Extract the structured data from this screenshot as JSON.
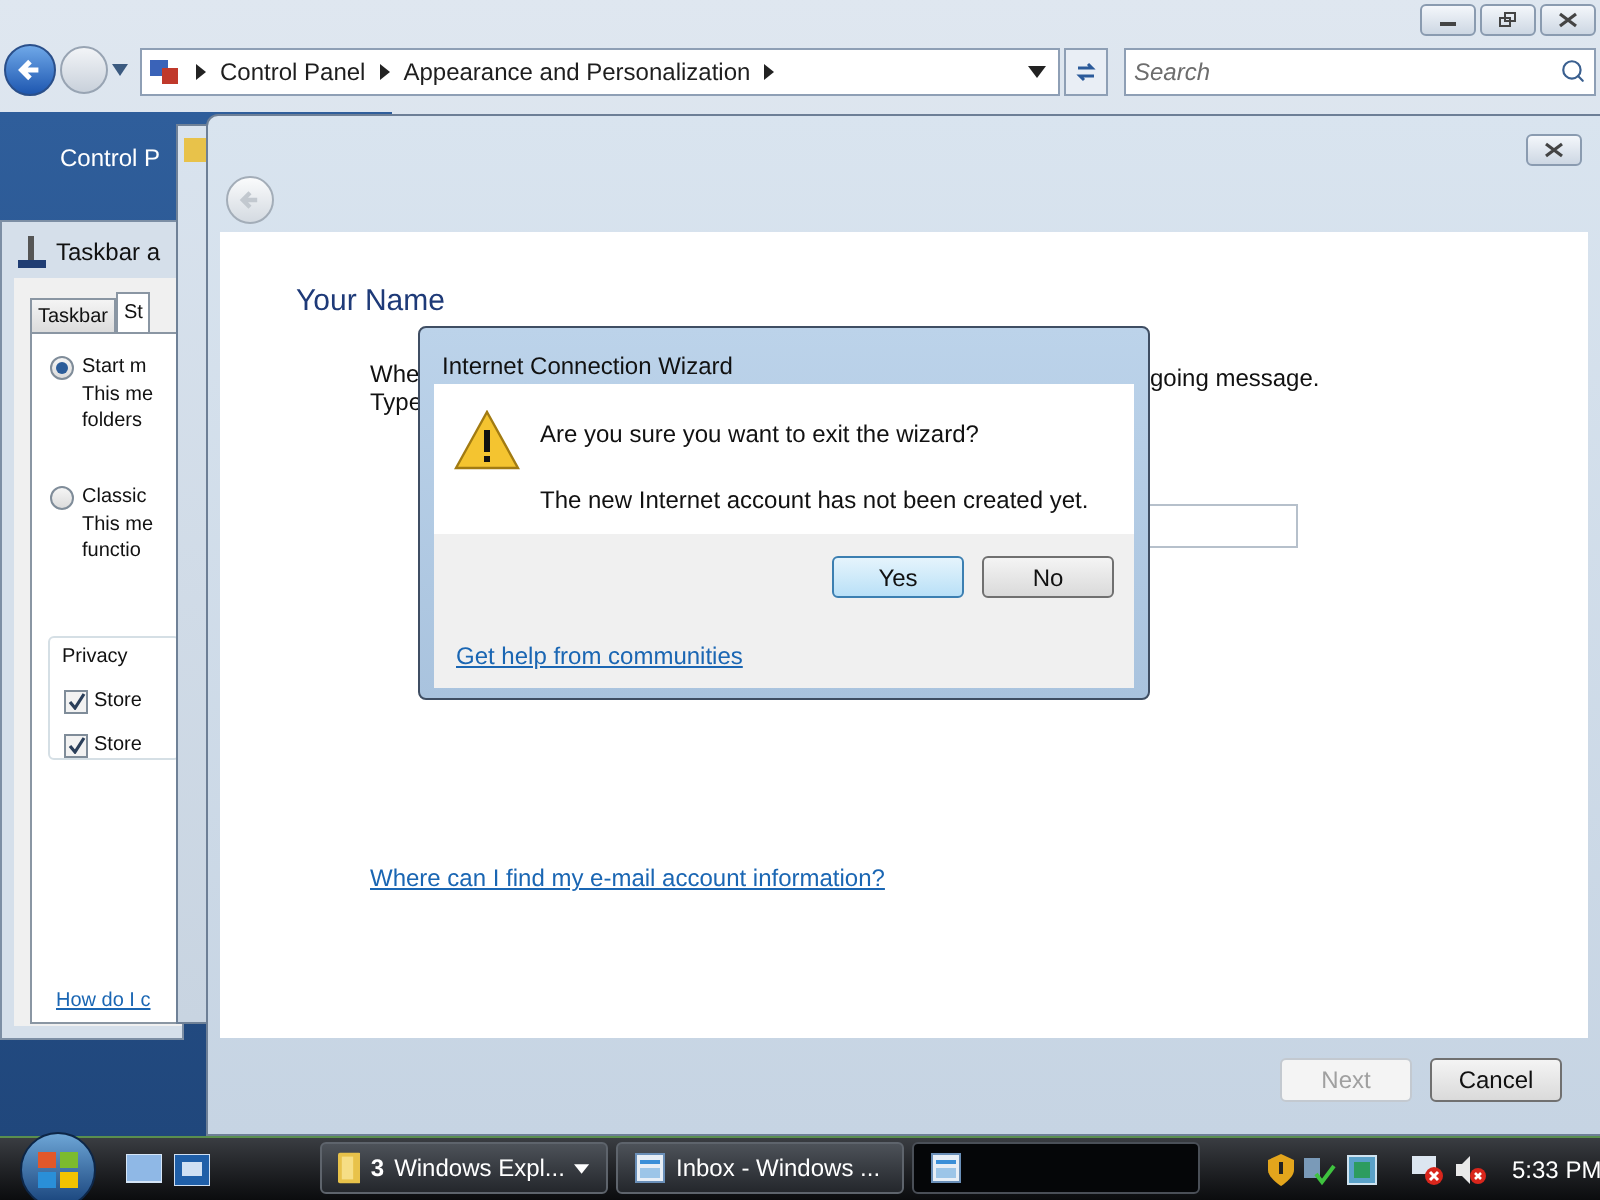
{
  "explorer": {
    "breadcrumbs": [
      "Control Panel",
      "Appearance and Personalization"
    ],
    "search": {
      "placeholder": "Search"
    },
    "left_pane": {
      "item": "Control P"
    }
  },
  "taskbar_properties": {
    "title": "Taskbar a",
    "tabs": [
      {
        "label": "Taskbar",
        "selected": false
      },
      {
        "label": "St",
        "selected": true
      }
    ],
    "options": [
      {
        "label": "Start m",
        "selected": true,
        "description": [
          "This me",
          "folders"
        ]
      },
      {
        "label": "Classic",
        "selected": false,
        "description": [
          "This me",
          "functio"
        ]
      }
    ],
    "privacy": {
      "title": "Privacy",
      "items": [
        {
          "label": "Store",
          "checked": true
        },
        {
          "label": "Store",
          "checked": true
        }
      ]
    },
    "help_link": "How do I c"
  },
  "wizard": {
    "heading": "Your Name",
    "intro_left": [
      "Whe",
      "Type"
    ],
    "intro_right": "going message.",
    "link": "Where can I find my e-mail account information?",
    "buttons": [
      {
        "label": "Next",
        "disabled": true
      },
      {
        "label": "Cancel",
        "disabled": false
      }
    ]
  },
  "dialog": {
    "title": "Internet Connection Wizard",
    "message": "Are you sure you want to exit the wizard?",
    "detail": "The new Internet account has not been created yet.",
    "buttons": [
      {
        "label": "Yes",
        "default": true
      },
      {
        "label": "No",
        "default": false
      }
    ],
    "link": "Get help from communities"
  },
  "taskbar": {
    "tasks": [
      {
        "count": "3",
        "label": "Windows Expl...",
        "kind": "folder",
        "active": false
      },
      {
        "label": "Inbox - Windows ...",
        "kind": "mail",
        "active": false
      },
      {
        "kind": "mail",
        "active": true
      }
    ],
    "clock": "5:33 PM"
  }
}
